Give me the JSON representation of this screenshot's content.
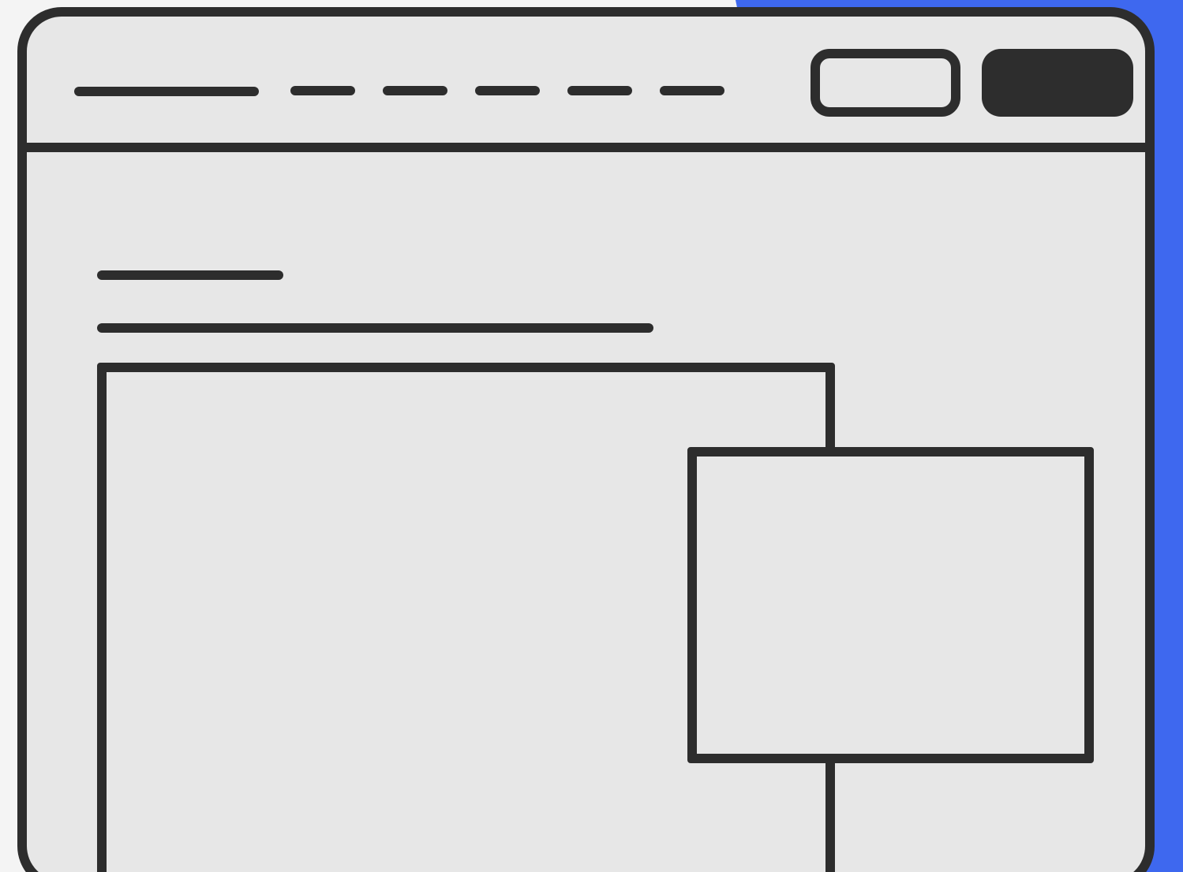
{
  "theme": {
    "background": "#f4f4f4",
    "window_fill": "#e7e7e7",
    "line_color": "#2d2d2d",
    "accent": "#3e68ef"
  },
  "header": {
    "brand_placeholder": "logo-line",
    "nav_items": [
      {
        "icon": "nav-item-1"
      },
      {
        "icon": "nav-item-2"
      },
      {
        "icon": "nav-item-3"
      },
      {
        "icon": "nav-item-4"
      },
      {
        "icon": "nav-item-5"
      }
    ],
    "outline_button": {
      "icon": "secondary-button"
    },
    "filled_button": {
      "icon": "primary-button"
    }
  },
  "main": {
    "heading_placeholder": "heading-line",
    "subtitle_placeholder": "subtitle-line",
    "media_frames": [
      {
        "icon": "large-media-frame"
      },
      {
        "icon": "small-media-frame"
      }
    ]
  }
}
